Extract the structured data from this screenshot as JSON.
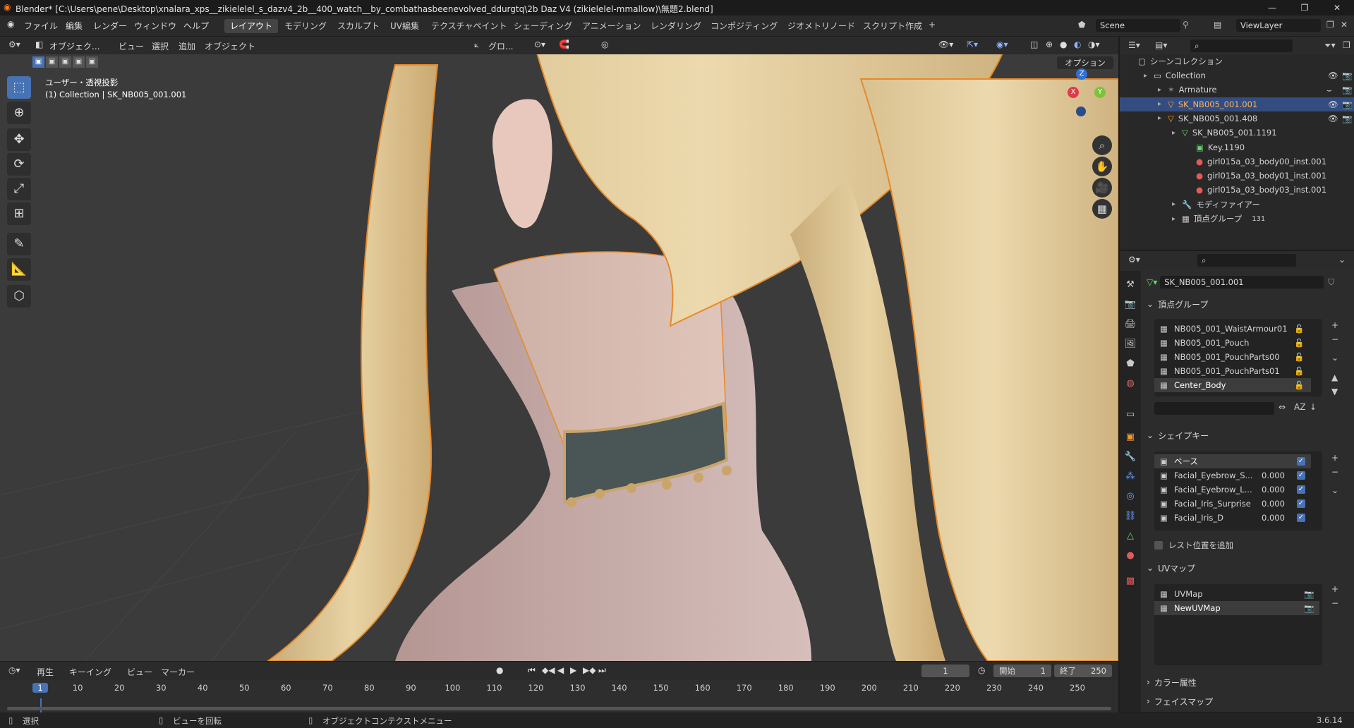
{
  "title": "Blender* [C:\\Users\\pene\\Desktop\\xnalara_xps__zikielelel_s_dazv4_2b__400_watch__by_combathasbeenevolved_ddurgtq\\2b Daz V4 (zikielelel-mmallow)\\無題2.blend]",
  "menu": [
    "ファイル",
    "編集",
    "レンダー",
    "ウィンドウ",
    "ヘルプ"
  ],
  "workspaces": [
    "レイアウト",
    "モデリング",
    "スカルプト",
    "UV編集",
    "テクスチャペイント",
    "シェーディング",
    "アニメーション",
    "レンダリング",
    "コンポジティング",
    "ジオメトリノード",
    "スクリプト作成"
  ],
  "scene": "Scene",
  "viewlayer": "ViewLayer",
  "viewport": {
    "mode": "オブジェク...",
    "menus": [
      "ビュー",
      "選択",
      "追加",
      "オブジェクト"
    ],
    "orientation": "グロ...",
    "options": "オプション",
    "view_name": "ユーザー・透視投影",
    "collection_info": "(1) Collection | SK_NB005_001.001",
    "gizmo": {
      "x": "X",
      "y": "Y",
      "z": "Z"
    }
  },
  "outliner": {
    "root": "シーンコレクション",
    "rows": [
      {
        "label": "Collection",
        "indent": 1,
        "icon": "collection-icon"
      },
      {
        "label": "Armature",
        "indent": 2,
        "icon": "armature-icon"
      },
      {
        "label": "SK_NB005_001.001",
        "indent": 2,
        "icon": "mesh-object-icon",
        "selected": true
      },
      {
        "label": "SK_NB005_001.408",
        "indent": 2,
        "icon": "mesh-object-icon"
      },
      {
        "label": "SK_NB005_001.1191",
        "indent": 3,
        "icon": "mesh-data-icon"
      },
      {
        "label": "Key.1190",
        "indent": 4,
        "icon": "shape-key-icon"
      },
      {
        "label": "girl015a_03_body00_inst.001",
        "indent": 4,
        "icon": "material-icon"
      },
      {
        "label": "girl015a_03_body01_inst.001",
        "indent": 4,
        "icon": "material-icon"
      },
      {
        "label": "girl015a_03_body03_inst.001",
        "indent": 4,
        "icon": "material-icon"
      },
      {
        "label": "モディファイアー",
        "indent": 3,
        "icon": "modifier-icon"
      },
      {
        "label": "頂点グループ",
        "indent": 3,
        "icon": "vertex-group-icon"
      }
    ],
    "vgroup_count": "131"
  },
  "properties": {
    "object_name": "SK_NB005_001.001",
    "vertex_groups_title": "頂点グループ",
    "vertex_groups": [
      "NB005_001_WaistArmour01",
      "NB005_001_Pouch",
      "NB005_001_PouchParts00",
      "NB005_001_PouchParts01",
      "Center_Body"
    ],
    "shape_keys_title": "シェイプキー",
    "shape_keys": [
      {
        "name": "ベース",
        "value": ""
      },
      {
        "name": "Facial_Eyebrow_S...",
        "value": "0.000"
      },
      {
        "name": "Facial_Eyebrow_L...",
        "value": "0.000"
      },
      {
        "name": "Facial_Iris_Surprise",
        "value": "0.000"
      },
      {
        "name": "Facial_Iris_D",
        "value": "0.000"
      }
    ],
    "rest_position": "レスト位置を追加",
    "uv_title": "UVマップ",
    "uv_maps": [
      "UVMap",
      "NewUVMap"
    ],
    "color_attr": "カラー属性",
    "face_maps": "フェイスマップ"
  },
  "timeline": {
    "menus": [
      "再生",
      "キーイング",
      "ビュー",
      "マーカー"
    ],
    "current": "1",
    "start_label": "開始",
    "start": "1",
    "end_label": "終了",
    "end": "250",
    "ticks": [
      "1",
      "10",
      "20",
      "30",
      "40",
      "50",
      "60",
      "70",
      "80",
      "90",
      "100",
      "110",
      "120",
      "130",
      "140",
      "150",
      "160",
      "170",
      "180",
      "190",
      "200",
      "210",
      "220",
      "230",
      "240",
      "250"
    ]
  },
  "status": {
    "select": "選択",
    "rotate": "ビューを回転",
    "context": "オブジェクトコンテクストメニュー",
    "version": "3.6.14"
  }
}
